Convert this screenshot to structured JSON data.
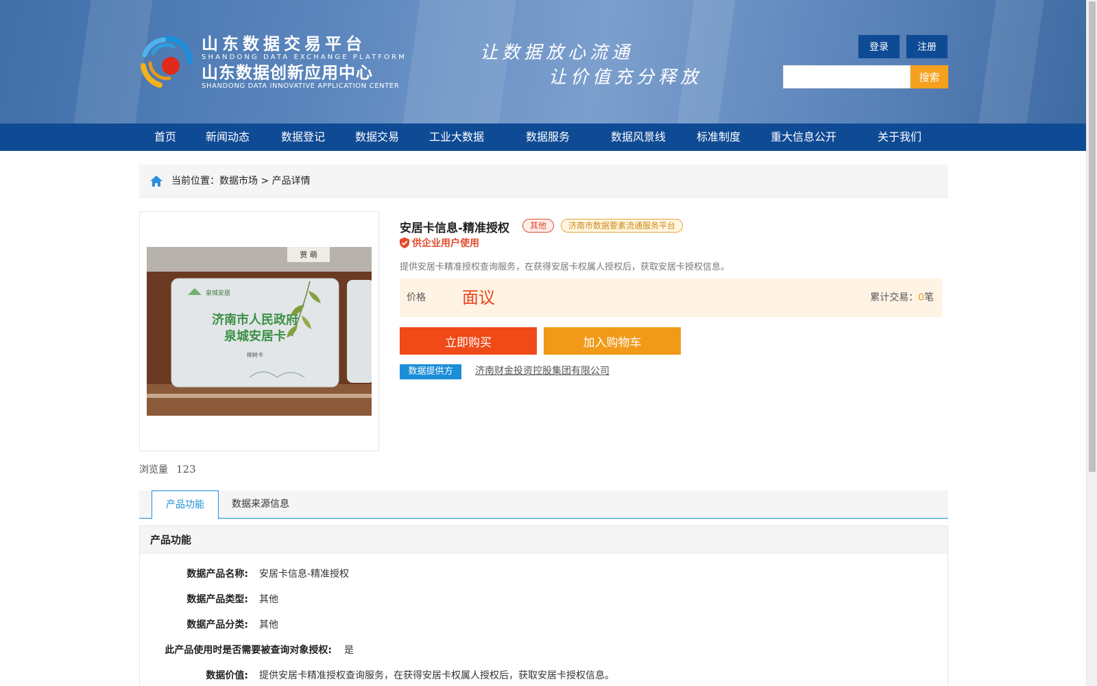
{
  "header": {
    "brand_cn1": "山东数据交易平台",
    "brand_en1": "SHANDONG DATA EXCHANGE PLATFORM",
    "brand_cn2": "山东数据创新应用中心",
    "brand_en2": "SHANDONG DATA INNOVATIVE APPLICATION CENTER",
    "slogan_line1": "让数据放心流通",
    "slogan_line2": "让价值充分释放",
    "login_label": "登录",
    "register_label": "注册",
    "search_value": "",
    "search_button_label": "搜索"
  },
  "nav": {
    "items": [
      {
        "label": "首页"
      },
      {
        "label": "新闻动态"
      },
      {
        "label": "数据登记"
      },
      {
        "label": "数据交易"
      },
      {
        "label": "工业大数据"
      },
      {
        "label": "数据服务"
      },
      {
        "label": "数据风景线"
      },
      {
        "label": "标准制度"
      },
      {
        "label": "重大信息公开"
      },
      {
        "label": "关于我们"
      }
    ]
  },
  "breadcrumb": {
    "prefix": "当前位置：",
    "level1": "数据市场",
    "separator": " > ",
    "level2": "产品详情"
  },
  "product": {
    "image_card_title": "济南市人民政府",
    "image_card_subtitle": "泉城安居卡",
    "image_card_logo_text": "泉城安居",
    "image_card_small": "柳树卡",
    "image_nameplate": "贾 萌",
    "views_label": "浏览量",
    "views_count": "123",
    "title": "安居卡信息-精准授权",
    "tag_category": "其他",
    "tag_platform": "济南市数据要素流通服务平台",
    "enterprise_label": "供企业用户使用",
    "description": "提供安居卡精准授权查询服务，在获得安居卡权属人授权后，获取安居卡授权信息。",
    "price_label": "价格",
    "price_value": "面议",
    "trades_label": "累计交易：",
    "trades_count": "0",
    "trades_unit": "笔",
    "buy_label": "立即购买",
    "cart_label": "加入购物车",
    "provider_label": "数据提供方",
    "provider_name": "济南财金投资控股集团有限公司"
  },
  "tabs": [
    {
      "label": "产品功能"
    },
    {
      "label": "数据来源信息"
    }
  ],
  "detail": {
    "heading": "产品功能",
    "rows": [
      {
        "key": "数据产品名称:",
        "value": "安居卡信息-精准授权"
      },
      {
        "key": "数据产品类型:",
        "value": "其他"
      },
      {
        "key": "数据产品分类:",
        "value": "其他"
      },
      {
        "key": "此产品使用时是否需要被查询对象授权:",
        "value": "是"
      },
      {
        "key": "数据价值:",
        "value": "提供安居卡精准授权查询服务，在获得安居卡权属人授权后，获取安居卡授权信息。"
      }
    ]
  },
  "colors": {
    "nav_blue": "#0f4a94",
    "accent_orange": "#f09a18",
    "buy_red": "#ef4a18",
    "link_blue": "#1b8ed8"
  }
}
